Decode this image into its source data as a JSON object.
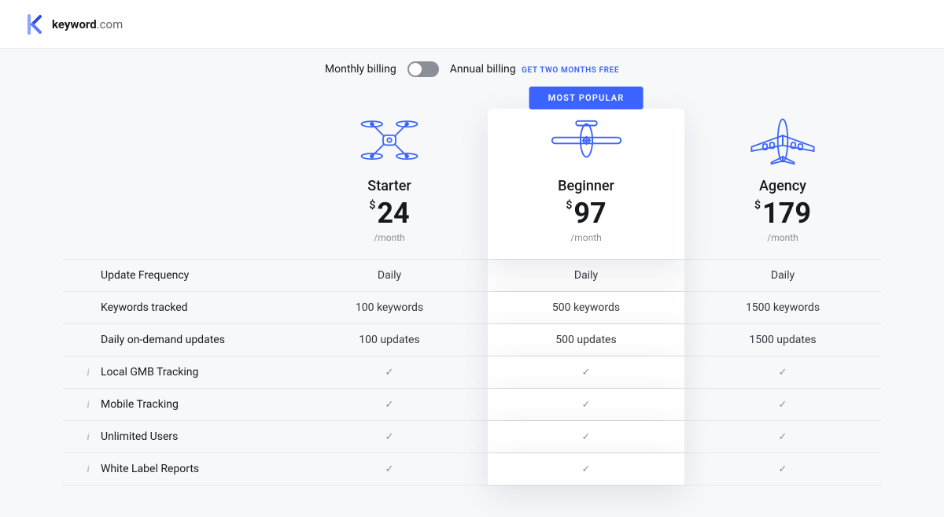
{
  "brand": {
    "name_bold": "keyword",
    "name_thin": ".com"
  },
  "billing": {
    "monthly": "Monthly billing",
    "annual": "Annual billing",
    "promo": "GET TWO MONTHS FREE"
  },
  "popular_badge": "MOST POPULAR",
  "currency": "$",
  "period": "/month",
  "plans": [
    {
      "id": "starter",
      "name": "Starter",
      "price": "24",
      "icon": "drone"
    },
    {
      "id": "beginner",
      "name": "Beginner",
      "price": "97",
      "icon": "plane-small",
      "popular": true
    },
    {
      "id": "agency",
      "name": "Agency",
      "price": "179",
      "icon": "plane-large"
    }
  ],
  "features": [
    {
      "label": "Update Frequency",
      "info": false,
      "values": [
        "Daily",
        "Daily",
        "Daily"
      ]
    },
    {
      "label": "Keywords tracked",
      "info": false,
      "values": [
        "100 keywords",
        "500 keywords",
        "1500 keywords"
      ]
    },
    {
      "label": "Daily on-demand updates",
      "info": false,
      "values": [
        "100 updates",
        "500 updates",
        "1500 updates"
      ]
    },
    {
      "label": "Local GMB Tracking",
      "info": true,
      "values": [
        "check",
        "check",
        "check"
      ]
    },
    {
      "label": "Mobile Tracking",
      "info": true,
      "values": [
        "check",
        "check",
        "check"
      ]
    },
    {
      "label": "Unlimited Users",
      "info": true,
      "values": [
        "check",
        "check",
        "check"
      ]
    },
    {
      "label": "White Label Reports",
      "info": true,
      "values": [
        "check",
        "check",
        "check"
      ]
    }
  ]
}
